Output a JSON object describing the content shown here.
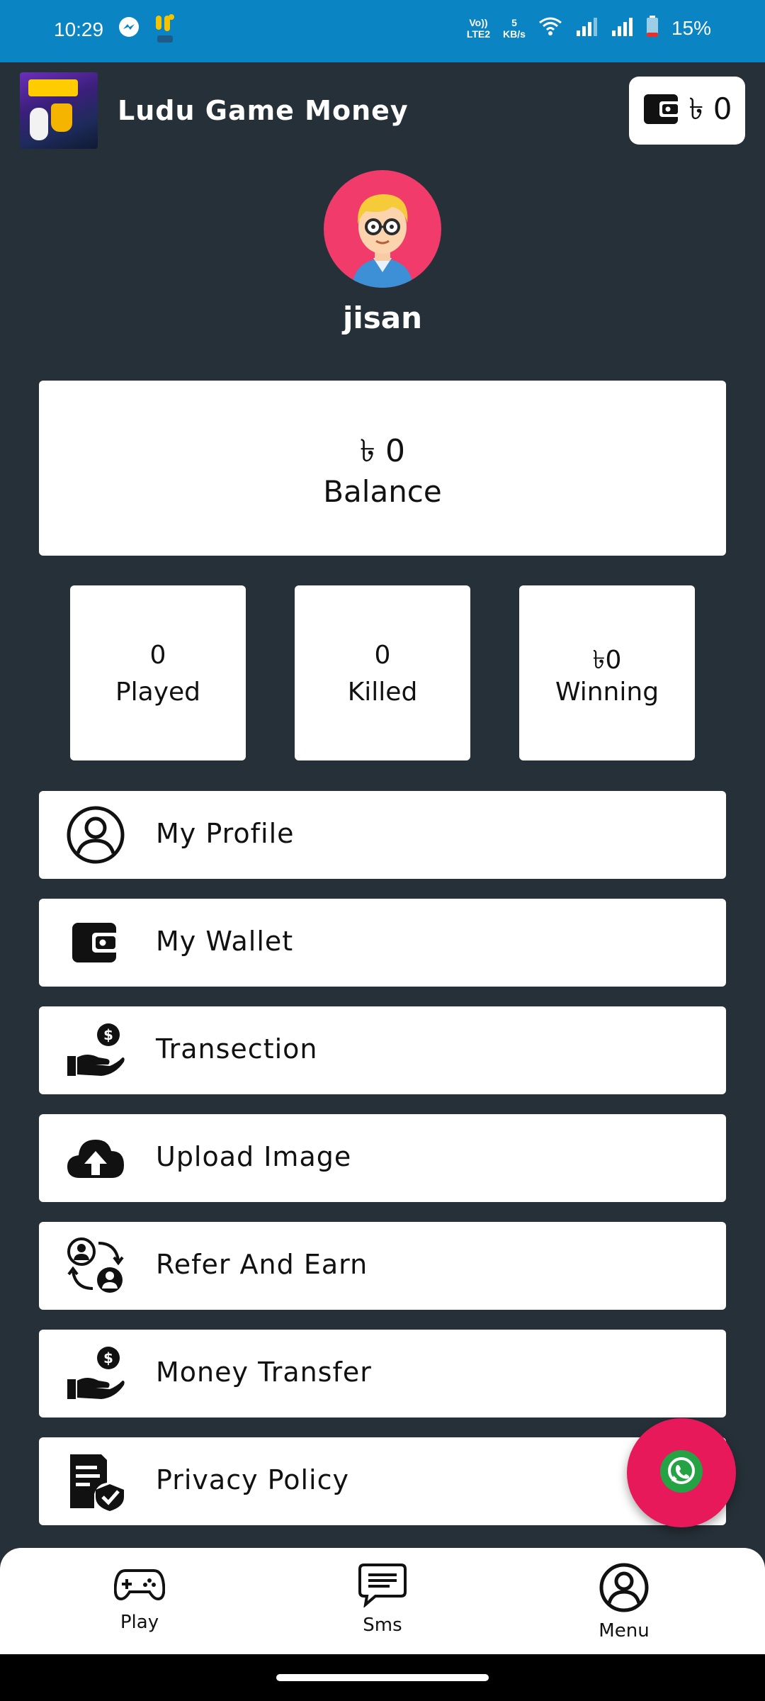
{
  "status_bar": {
    "time": "10:29",
    "volte": "Vo))",
    "lte": "LTE2",
    "speed": "5",
    "speed_unit": "KB/s",
    "battery": "15%"
  },
  "header": {
    "title": "Ludu Game Money",
    "wallet_amount": "৳ 0"
  },
  "profile": {
    "username": "jisan"
  },
  "balance": {
    "value": "৳ 0",
    "label": "Balance"
  },
  "stats": [
    {
      "value": "0",
      "label": "Played"
    },
    {
      "value": "0",
      "label": "Killed"
    },
    {
      "value": "৳0",
      "label": "Winning"
    }
  ],
  "menu": [
    {
      "label": "My Profile",
      "icon": "user-circle-icon"
    },
    {
      "label": "My Wallet",
      "icon": "wallet-icon"
    },
    {
      "label": "Transection",
      "icon": "hand-money-icon"
    },
    {
      "label": "Upload Image",
      "icon": "cloud-upload-icon"
    },
    {
      "label": "Refer And Earn",
      "icon": "refer-users-icon"
    },
    {
      "label": "Money Transfer",
      "icon": "hand-money-icon"
    },
    {
      "label": "Privacy Policy",
      "icon": "policy-shield-icon"
    }
  ],
  "bottom_nav": [
    {
      "label": "Play",
      "icon": "gamepad-icon"
    },
    {
      "label": "Sms",
      "icon": "chat-icon"
    },
    {
      "label": "Menu",
      "icon": "user-circle-icon"
    }
  ],
  "colors": {
    "status_bar": "#0a84c2",
    "background": "#263038",
    "avatar_bg": "#f13b6a",
    "fab": "#e8195a",
    "whatsapp": "#25a244"
  }
}
